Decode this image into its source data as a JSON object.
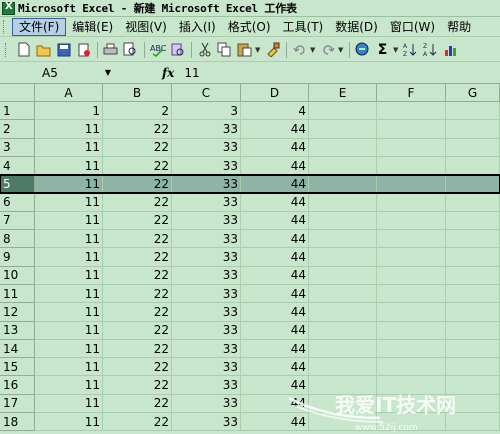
{
  "window": {
    "title": "Microsoft Excel - 新建 Microsoft Excel 工作表"
  },
  "menu": {
    "items": [
      {
        "label": "文件(F)",
        "name": "menu-file",
        "active": true
      },
      {
        "label": "编辑(E)",
        "name": "menu-edit"
      },
      {
        "label": "视图(V)",
        "name": "menu-view"
      },
      {
        "label": "插入(I)",
        "name": "menu-insert"
      },
      {
        "label": "格式(O)",
        "name": "menu-format"
      },
      {
        "label": "工具(T)",
        "name": "menu-tools"
      },
      {
        "label": "数据(D)",
        "name": "menu-data"
      },
      {
        "label": "窗口(W)",
        "name": "menu-window"
      },
      {
        "label": "帮助",
        "name": "menu-help"
      }
    ]
  },
  "toolbar": {
    "icons": [
      "new-icon",
      "open-icon",
      "save-icon",
      "permission-icon",
      "print-icon",
      "print-preview-icon",
      "spelling-icon",
      "research-icon",
      "cut-icon",
      "copy-icon",
      "paste-icon",
      "format-painter-icon",
      "undo-icon",
      "redo-icon",
      "hyperlink-icon",
      "autosum-icon",
      "sort-ascending-icon",
      "sort-descending-icon",
      "chart-wizard-icon"
    ]
  },
  "formula_bar": {
    "name_box": "A5",
    "fx_label": "fx",
    "value": "11"
  },
  "sheet": {
    "columns": [
      "A",
      "B",
      "C",
      "D",
      "E",
      "F",
      "G"
    ],
    "selected_row": 5,
    "rows": [
      {
        "num": "1",
        "cells": [
          "1",
          "2",
          "3",
          "4",
          "",
          "",
          ""
        ]
      },
      {
        "num": "2",
        "cells": [
          "11",
          "22",
          "33",
          "44",
          "",
          "",
          ""
        ]
      },
      {
        "num": "3",
        "cells": [
          "11",
          "22",
          "33",
          "44",
          "",
          "",
          ""
        ]
      },
      {
        "num": "4",
        "cells": [
          "11",
          "22",
          "33",
          "44",
          "",
          "",
          ""
        ]
      },
      {
        "num": "5",
        "cells": [
          "11",
          "22",
          "33",
          "44",
          "",
          "",
          ""
        ]
      },
      {
        "num": "6",
        "cells": [
          "11",
          "22",
          "33",
          "44",
          "",
          "",
          ""
        ]
      },
      {
        "num": "7",
        "cells": [
          "11",
          "22",
          "33",
          "44",
          "",
          "",
          ""
        ]
      },
      {
        "num": "8",
        "cells": [
          "11",
          "22",
          "33",
          "44",
          "",
          "",
          ""
        ]
      },
      {
        "num": "9",
        "cells": [
          "11",
          "22",
          "33",
          "44",
          "",
          "",
          ""
        ]
      },
      {
        "num": "10",
        "cells": [
          "11",
          "22",
          "33",
          "44",
          "",
          "",
          ""
        ]
      },
      {
        "num": "11",
        "cells": [
          "11",
          "22",
          "33",
          "44",
          "",
          "",
          ""
        ]
      },
      {
        "num": "12",
        "cells": [
          "11",
          "22",
          "33",
          "44",
          "",
          "",
          ""
        ]
      },
      {
        "num": "13",
        "cells": [
          "11",
          "22",
          "33",
          "44",
          "",
          "",
          ""
        ]
      },
      {
        "num": "14",
        "cells": [
          "11",
          "22",
          "33",
          "44",
          "",
          "",
          ""
        ]
      },
      {
        "num": "15",
        "cells": [
          "11",
          "22",
          "33",
          "44",
          "",
          "",
          ""
        ]
      },
      {
        "num": "16",
        "cells": [
          "11",
          "22",
          "33",
          "44",
          "",
          "",
          ""
        ]
      },
      {
        "num": "17",
        "cells": [
          "11",
          "22",
          "33",
          "44",
          "",
          "",
          ""
        ]
      },
      {
        "num": "18",
        "cells": [
          "11",
          "22",
          "33",
          "44",
          "",
          "",
          ""
        ]
      }
    ]
  },
  "watermark": {
    "text": "我爱IT技术网",
    "url": "www.52ij.com"
  }
}
